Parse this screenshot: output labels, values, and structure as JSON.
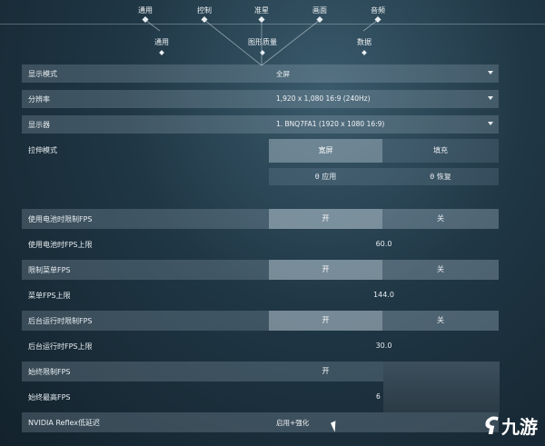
{
  "top_tabs": [
    "通用",
    "控制",
    "准星",
    "画面",
    "音频"
  ],
  "sub_tabs": [
    "通用",
    "图形质量",
    "数据"
  ],
  "settings": {
    "display_mode": {
      "label": "显示模式",
      "value": "全屏"
    },
    "resolution": {
      "label": "分辨率",
      "value": "1,920 x 1,080 16:9 (240Hz)"
    },
    "monitor": {
      "label": "显示器",
      "value": "1. BNQ7FA1 (1920 x  1080 16:9)"
    },
    "stretch_mode": {
      "label": "拉伸模式",
      "option_on": "宽屏",
      "option_off": "填充"
    },
    "apply_label": "应用",
    "restore_label": "恢复",
    "battery_limit": {
      "label": "使用电池时限制FPS",
      "on": "开",
      "off": "关"
    },
    "battery_cap": {
      "label": "使用电池时FPS上限",
      "value": "60.0"
    },
    "menu_limit": {
      "label": "限制菜单FPS",
      "on": "开",
      "off": "关"
    },
    "menu_cap": {
      "label": "菜单FPS上限",
      "value": "144.0"
    },
    "bg_limit": {
      "label": "后台运行时限制FPS",
      "on": "开",
      "off": "关"
    },
    "bg_cap": {
      "label": "后台运行时FPS上限",
      "value": "30.0"
    },
    "always_limit": {
      "label": "始终限制FPS",
      "on": "开"
    },
    "always_cap": {
      "label": "始终最高FPS",
      "value": "6"
    },
    "reflex": {
      "label": "NVIDIA Reflex低延迟",
      "value": "启用+强化"
    }
  },
  "watermark": {
    "glyph": "ʕ",
    "name": "九游"
  }
}
